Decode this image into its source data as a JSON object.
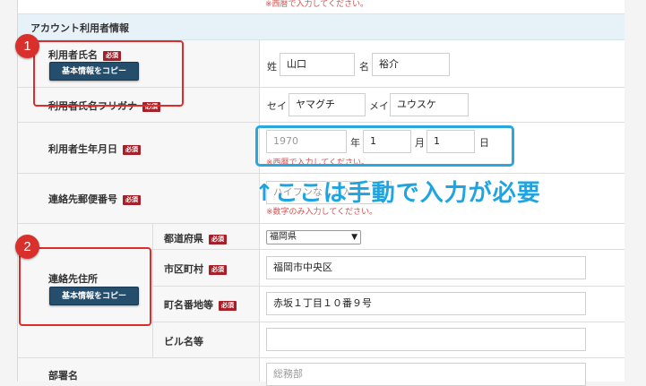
{
  "top_note": "※西暦で入力してください。",
  "section_title": "アカウント利用者情報",
  "required_badge": "必須",
  "rows": {
    "user_name": {
      "label": "利用者氏名",
      "copy_button": "基本情報をコピー",
      "sei_label": "姓",
      "sei_value": "山口",
      "mei_label": "名",
      "mei_value": "裕介"
    },
    "user_kana": {
      "label": "利用者氏名フリガナ",
      "sei_label": "セイ",
      "sei_value": "ヤマグチ",
      "mei_label": "メイ",
      "mei_value": "ユウスケ"
    },
    "birthdate": {
      "label": "利用者生年月日",
      "year_placeholder": "1970",
      "year_unit": "年",
      "month_value": "1",
      "month_unit": "月",
      "day_value": "1",
      "day_unit": "日",
      "note": "※西暦で入力してください。"
    },
    "postal": {
      "label": "連絡先郵便番号",
      "placeholder": "ハイフンなしで入力してください",
      "note": "※数字のみ入力してください。"
    },
    "address": {
      "label": "連絡先住所",
      "copy_button": "基本情報をコピー",
      "prefecture_label": "都道府県",
      "prefecture_value": "福岡県",
      "city_label": "市区町村",
      "city_value": "福岡市中央区",
      "street_label": "町名番地等",
      "street_value": "赤坂１丁目１０番９号",
      "building_label": "ビル名等",
      "building_value": ""
    },
    "department": {
      "label": "部署名",
      "placeholder": "総務部"
    }
  },
  "annotations": {
    "badge1": "1",
    "badge2": "2",
    "manual_input": "↑ここは手動で入力が必要"
  },
  "colors": {
    "required": "#a6202a",
    "copy_button": "#244e6c",
    "highlight_red": "#e02b2b",
    "highlight_blue": "#29a8e0",
    "note_red": "#d05050"
  }
}
